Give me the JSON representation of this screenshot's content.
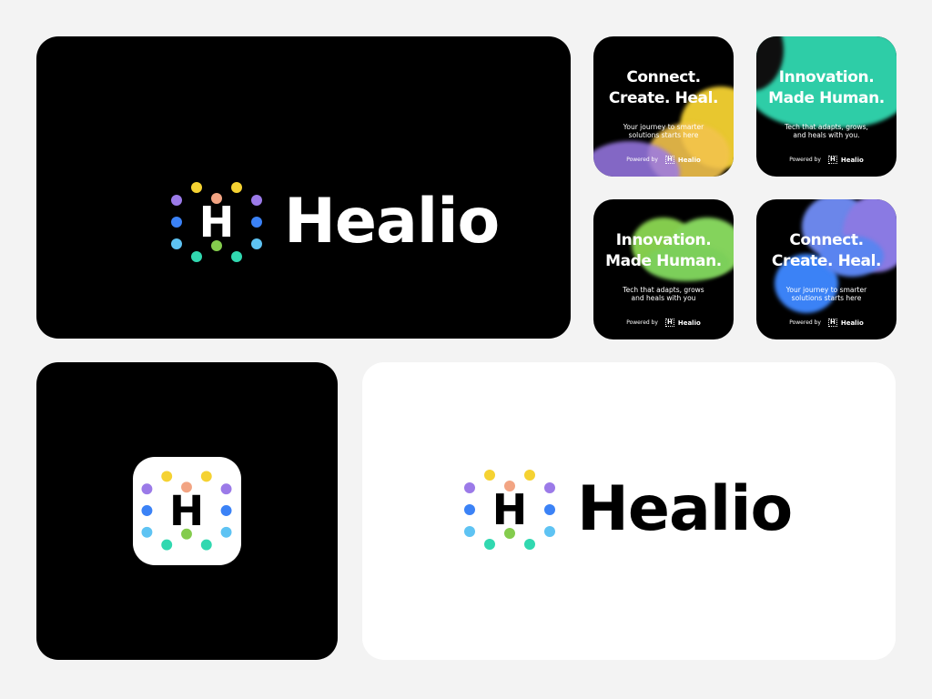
{
  "brand": {
    "name": "Healio",
    "mark_letter": "H",
    "dot_colors": {
      "yellow": "#f5d232",
      "peach": "#f2a483",
      "purple": "#9b7ae8",
      "blue": "#3b82f6",
      "cyan": "#5ec3f3",
      "mint": "#31d8b0",
      "green": "#84cc4d"
    }
  },
  "cards": [
    {
      "headline_line1": "Connect.",
      "headline_line2": "Create. Heal.",
      "sub_line1": "Your journey to smarter",
      "sub_line2": "solutions starts here",
      "powered_by": "Powered by",
      "brand": "Healio"
    },
    {
      "headline_line1": "Innovation.",
      "headline_line2": "Made Human.",
      "sub_line1": "Tech that adapts, grows,",
      "sub_line2": "and heals with you.",
      "powered_by": "Powered by",
      "brand": "Healio"
    },
    {
      "headline_line1": "Innovation.",
      "headline_line2": "Made Human.",
      "sub_line1": "Tech that adapts, grows",
      "sub_line2": "and heals with you",
      "powered_by": "Powered by",
      "brand": "Healio"
    },
    {
      "headline_line1": "Connect.",
      "headline_line2": "Create. Heal.",
      "sub_line1": "Your journey to smarter",
      "sub_line2": "solutions starts here",
      "powered_by": "Powered by",
      "brand": "Healio"
    }
  ]
}
